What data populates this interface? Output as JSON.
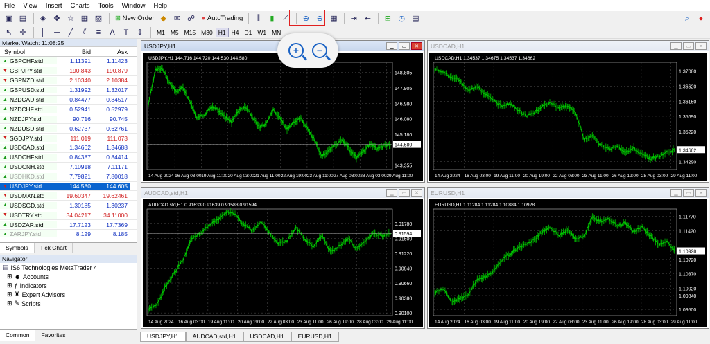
{
  "menu": [
    "File",
    "View",
    "Insert",
    "Charts",
    "Tools",
    "Window",
    "Help"
  ],
  "toolbar": {
    "new_order": "New Order",
    "auto_trading": "AutoTrading"
  },
  "timeframes": [
    "M1",
    "M5",
    "M15",
    "M30",
    "H1",
    "H4",
    "D1",
    "W1",
    "MN"
  ],
  "active_timeframe": "H1",
  "market_watch": {
    "title": "Market Watch: 11:08:25",
    "headers": {
      "symbol": "Symbol",
      "bid": "Bid",
      "ask": "Ask"
    },
    "rows": [
      {
        "symbol": "GBPCHF.std",
        "bid": "1.11391",
        "ask": "1.11423",
        "dir": "up",
        "color": "blue"
      },
      {
        "symbol": "GBPJPY.std",
        "bid": "190.843",
        "ask": "190.879",
        "dir": "down",
        "color": "red"
      },
      {
        "symbol": "GBPNZD.std",
        "bid": "2.10340",
        "ask": "2.10384",
        "dir": "down",
        "color": "red"
      },
      {
        "symbol": "GBPUSD.std",
        "bid": "1.31992",
        "ask": "1.32017",
        "dir": "up",
        "color": "blue"
      },
      {
        "symbol": "NZDCAD.std",
        "bid": "0.84477",
        "ask": "0.84517",
        "dir": "up",
        "color": "blue"
      },
      {
        "symbol": "NZDCHF.std",
        "bid": "0.52941",
        "ask": "0.52979",
        "dir": "up",
        "color": "blue"
      },
      {
        "symbol": "NZDJPY.std",
        "bid": "90.716",
        "ask": "90.745",
        "dir": "up",
        "color": "blue"
      },
      {
        "symbol": "NZDUSD.std",
        "bid": "0.62737",
        "ask": "0.62761",
        "dir": "up",
        "color": "blue"
      },
      {
        "symbol": "SGDJPY.std",
        "bid": "111.019",
        "ask": "111.073",
        "dir": "down",
        "color": "red"
      },
      {
        "symbol": "USDCAD.std",
        "bid": "1.34662",
        "ask": "1.34688",
        "dir": "up",
        "color": "blue"
      },
      {
        "symbol": "USDCHF.std",
        "bid": "0.84387",
        "ask": "0.84414",
        "dir": "up",
        "color": "blue"
      },
      {
        "symbol": "USDCNH.std",
        "bid": "7.10918",
        "ask": "7.11171",
        "dir": "up",
        "color": "blue"
      },
      {
        "symbol": "USDHKD.std",
        "bid": "7.79821",
        "ask": "7.80018",
        "dir": "up",
        "color": "blue",
        "dim": true
      },
      {
        "symbol": "USDJPY.std",
        "bid": "144.580",
        "ask": "144.605",
        "dir": "down",
        "color": "red",
        "selected": true
      },
      {
        "symbol": "USDMXN.std",
        "bid": "19.60347",
        "ask": "19.62461",
        "dir": "down",
        "color": "red"
      },
      {
        "symbol": "USDSGD.std",
        "bid": "1.30185",
        "ask": "1.30237",
        "dir": "up",
        "color": "blue"
      },
      {
        "symbol": "USDTRY.std",
        "bid": "34.04217",
        "ask": "34.11000",
        "dir": "down",
        "color": "red"
      },
      {
        "symbol": "USDZAR.std",
        "bid": "17.7123",
        "ask": "17.7369",
        "dir": "up",
        "color": "blue"
      },
      {
        "symbol": "ZARJPY.std",
        "bid": "8.129",
        "ask": "8.185",
        "dir": "up",
        "color": "blue",
        "dim": true
      }
    ],
    "tabs": [
      "Symbols",
      "Tick Chart"
    ]
  },
  "navigator": {
    "title": "Navigator",
    "root": "IS6 Technologies MetaTrader 4",
    "items": [
      "Accounts",
      "Indicators",
      "Expert Advisors",
      "Scripts"
    ],
    "tabs": [
      "Common",
      "Favorites"
    ]
  },
  "charts": [
    {
      "title": "USDJPY,H1",
      "info": "USDJPY,H1  144.716 144.720 144.530 144.580",
      "active": true,
      "yticks": [
        "148.805",
        "147.905",
        "146.980",
        "146.080",
        "145.180",
        "144.580",
        "143.355"
      ],
      "highlight": "144.580",
      "xticks": [
        "14 Aug 2024",
        "16 Aug 03:00",
        "19 Aug 11:00",
        "20 Aug 03:00",
        "21 Aug 11:00",
        "22 Aug 19:00",
        "23 Aug 11:00",
        "27 Aug 03:00",
        "28 Aug 03:00",
        "29 Aug 11:00"
      ],
      "ylim": [
        143.1,
        149.4
      ],
      "series": [
        146.9,
        148.9,
        149.1,
        148.2,
        147.7,
        147.9,
        147.1,
        146.1,
        146.3,
        146.8,
        146.6,
        146.2,
        145.9,
        146.6,
        146.8,
        146.2,
        145.6,
        145.8,
        146.6,
        146.1,
        145.5,
        145.9,
        146.1,
        145.5,
        144.8,
        143.9,
        144.2,
        144.6,
        144.8,
        144.3,
        143.8,
        144.2,
        144.6,
        144.3,
        144.5,
        144.58
      ]
    },
    {
      "title": "USDCAD,H1",
      "info": "USDCAD,H1  1.34537 1.34675 1.34537 1.34662",
      "active": false,
      "yticks": [
        "1.37080",
        "1.36620",
        "1.36150",
        "1.35690",
        "1.35220",
        "1.34662",
        "1.34290"
      ],
      "highlight": "1.34662",
      "xticks": [
        "14 Aug 2024",
        "16 Aug 03:00",
        "19 Aug 11:00",
        "20 Aug 19:00",
        "22 Aug 03:00",
        "23 Aug 11:00",
        "26 Aug 19:00",
        "28 Aug 03:00",
        "29 Aug 11:00"
      ],
      "ylim": [
        1.3405,
        1.3735
      ],
      "series": [
        1.3715,
        1.3705,
        1.369,
        1.368,
        1.365,
        1.366,
        1.364,
        1.362,
        1.36,
        1.361,
        1.359,
        1.357,
        1.358,
        1.36,
        1.361,
        1.3595,
        1.36,
        1.358,
        1.35,
        1.351,
        1.348,
        1.347,
        1.3475,
        1.346,
        1.347,
        1.345,
        1.344,
        1.3445,
        1.346,
        1.3466
      ]
    },
    {
      "title": "AUDCAD,std,H1",
      "info": "AUDCAD.std,H1  0.91633 0.91639 0.91583 0.91594",
      "active": false,
      "yticks": [
        "0.91780",
        "0.91594",
        "0.91500",
        "0.91220",
        "0.90940",
        "0.90660",
        "0.90380",
        "0.90100"
      ],
      "highlight": "0.91594",
      "xticks": [
        "14 Aug 2024",
        "16 Aug 03:00",
        "19 Aug 11:00",
        "20 Aug 19:00",
        "22 Aug 03:00",
        "23 Aug 11:00",
        "26 Aug 19:00",
        "28 Aug 03:00",
        "29 Aug 11:00"
      ],
      "ylim": [
        0.9005,
        0.9205
      ],
      "series": [
        0.9015,
        0.9025,
        0.906,
        0.9085,
        0.911,
        0.915,
        0.916,
        0.9175,
        0.9185,
        0.92,
        0.9195,
        0.9175,
        0.9165,
        0.918,
        0.916,
        0.914,
        0.9145,
        0.917,
        0.915,
        0.9135,
        0.9155,
        0.9125,
        0.9135,
        0.915,
        0.913,
        0.9145,
        0.916,
        0.9155,
        0.9159
      ]
    },
    {
      "title": "EURUSD,H1",
      "info": "EURUSD,H1  1.11284 1.11284 1.10884 1.10928",
      "active": false,
      "yticks": [
        "1.11770",
        "1.11420",
        "1.10928",
        "1.10720",
        "1.10370",
        "1.10020",
        "1.09840",
        "1.09500"
      ],
      "highlight": "1.10928",
      "xticks": [
        "14 Aug 2024",
        "16 Aug 03:00",
        "19 Aug 11:00",
        "20 Aug 19:00",
        "22 Aug 03:00",
        "23 Aug 11:00",
        "26 Aug 19:00",
        "28 Aug 03:00",
        "29 Aug 11:00"
      ],
      "ylim": [
        1.0935,
        1.1195
      ],
      "series": [
        1.099,
        1.1,
        1.097,
        1.0975,
        1.0985,
        1.102,
        1.103,
        1.104,
        1.107,
        1.1085,
        1.11,
        1.111,
        1.112,
        1.114,
        1.115,
        1.113,
        1.1145,
        1.112,
        1.113,
        1.1175,
        1.1165,
        1.117,
        1.1155,
        1.116,
        1.114,
        1.115,
        1.113,
        1.111,
        1.1115,
        1.1093
      ]
    }
  ],
  "window_tabs": [
    "USDJPY,H1",
    "AUDCAD,std,H1",
    "USDCAD,H1",
    "EURUSD,H1"
  ],
  "colors": {
    "chart_bg": "#000000",
    "candle": "#00c000",
    "grid": "#808080",
    "highlight": "#e02020"
  }
}
